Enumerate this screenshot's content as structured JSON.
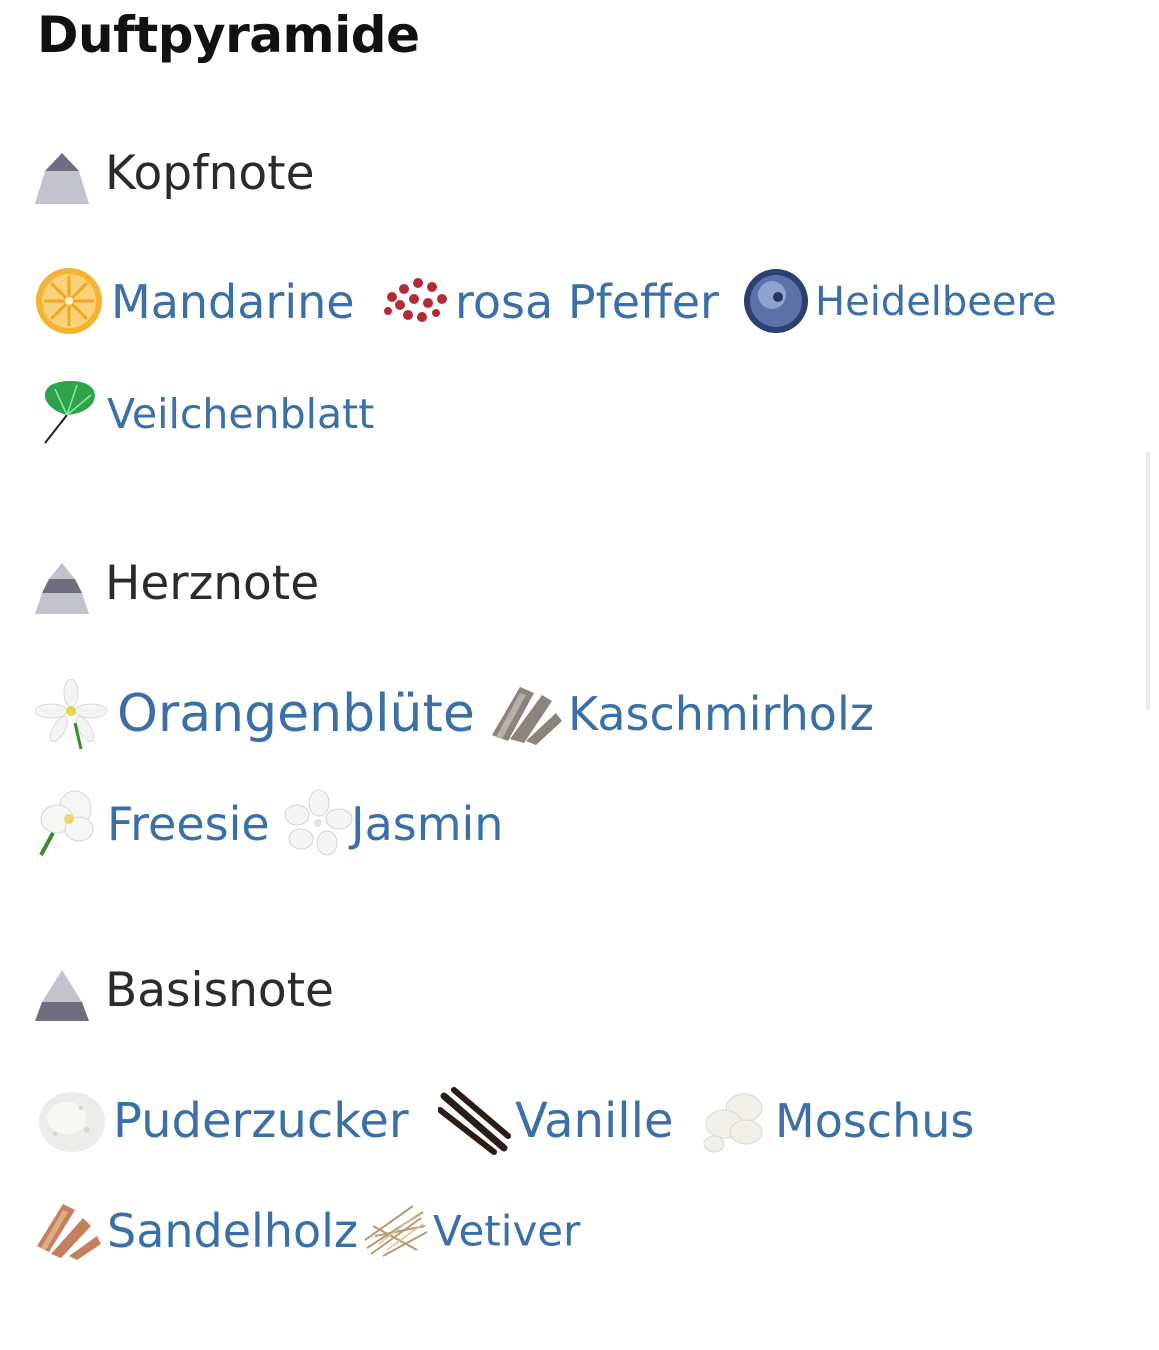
{
  "title": "Duftpyramide",
  "colors": {
    "link": "#3a6fa8",
    "heading": "#2b2b2b",
    "tier_light": "#c3c3cd",
    "tier_dark": "#6e6e80"
  },
  "tiers": [
    {
      "label": "Kopfnote",
      "notes": [
        {
          "label": "Mandarine",
          "icon": "mandarine-icon"
        },
        {
          "label": "rosa Pfeffer",
          "icon": "pink-pepper-icon"
        },
        {
          "label": "Heidelbeere",
          "icon": "blueberry-icon"
        },
        {
          "label": "Veilchenblatt",
          "icon": "violet-leaf-icon"
        }
      ]
    },
    {
      "label": "Herznote",
      "notes": [
        {
          "label": "Orangenblüte",
          "icon": "orange-blossom-icon"
        },
        {
          "label": "Kaschmirholz",
          "icon": "cashmere-wood-icon"
        },
        {
          "label": "Freesie",
          "icon": "freesia-icon"
        },
        {
          "label": "Jasmin",
          "icon": "jasmine-icon"
        }
      ]
    },
    {
      "label": "Basisnote",
      "notes": [
        {
          "label": "Puderzucker",
          "icon": "powdered-sugar-icon"
        },
        {
          "label": "Vanille",
          "icon": "vanilla-icon"
        },
        {
          "label": "Moschus",
          "icon": "musk-icon"
        },
        {
          "label": "Sandelholz",
          "icon": "sandalwood-icon"
        },
        {
          "label": "Vetiver",
          "icon": "vetiver-icon"
        }
      ]
    }
  ]
}
